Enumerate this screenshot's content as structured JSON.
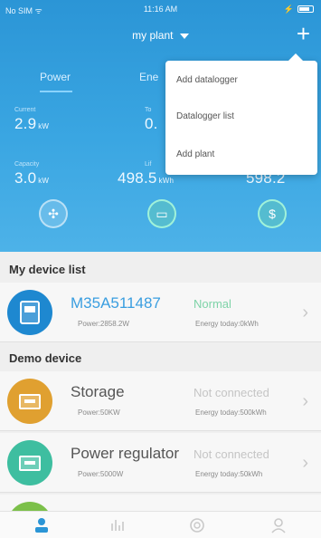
{
  "statusbar": {
    "carrier": "No SIM ᯤ",
    "time": "11:16 AM",
    "battery": "⚡"
  },
  "nav": {
    "plant_name": "my plant",
    "add_symbol": "+"
  },
  "tabs": [
    {
      "label": "Power"
    },
    {
      "label": "Ene"
    }
  ],
  "metrics": {
    "current_label": "Current",
    "current_value": "2.9",
    "current_unit": "kW",
    "col2_top_label": "To",
    "col2_top_value": "0.",
    "capacity_label": "Capacity",
    "capacity_value": "3.0",
    "capacity_unit": "kW",
    "col2_bottom_label": "Lif",
    "col2_bottom_value": "498.5",
    "col2_bottom_unit": "kWh",
    "col3_bottom_value": "598.2"
  },
  "dropdown": {
    "items": [
      "Add datalogger",
      "Datalogger list",
      "Add plant"
    ]
  },
  "my_device_list": {
    "title": "My device list",
    "devices": [
      {
        "name": "M35A511487",
        "power": "Power:2858.2W",
        "status": "Normal",
        "energy": "Energy today:0kWh",
        "icon_color": "#1e88d0",
        "name_color": "#3a9ee0",
        "status_color": "#7ed3a8"
      }
    ]
  },
  "demo_device": {
    "title": "Demo device",
    "devices": [
      {
        "name": "Storage",
        "power": "Power:50KW",
        "status": "Not connected",
        "energy": "Energy today:500kWh",
        "icon_color": "#e0a030",
        "name_color": "#555555",
        "status_color": "#c5c5c5"
      },
      {
        "name": "Power regulator",
        "power": "Power:5000W",
        "status": "Not connected",
        "energy": "Energy today:50kWh",
        "icon_color": "#3ebea0",
        "name_color": "#555555",
        "status_color": "#c5c5c5"
      }
    ]
  },
  "colors": {
    "header_blue": "#2b95d6",
    "accent": "#3a9ee0"
  },
  "icons": {
    "header_circles": [
      "fan-icon",
      "chat-icon",
      "dollar-icon"
    ],
    "tabbar": [
      "plant-icon",
      "chart-icon",
      "service-icon",
      "user-icon"
    ]
  }
}
